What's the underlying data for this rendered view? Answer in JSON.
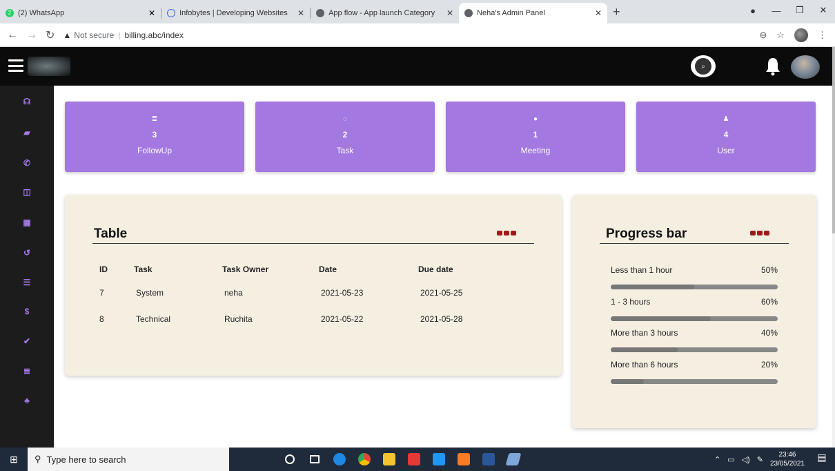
{
  "browser": {
    "tabs": [
      {
        "title": "(2) WhatsApp",
        "favicon_color": "#25d366",
        "favicon_text": "2"
      },
      {
        "title": "Infobytes | Developing Websites",
        "favicon_color": "#3d6bd9"
      },
      {
        "title": "App flow - App launch Category",
        "favicon_color": "#5f6368"
      },
      {
        "title": "Neha's Admin Panel",
        "favicon_color": "#5f6368",
        "active": true
      }
    ],
    "new_tab": "+",
    "address": {
      "security": "Not secure",
      "url": "billing.abc/index"
    }
  },
  "header": {
    "menu_icon": "hamburger-icon",
    "search_icon": "search-icon",
    "bell_icon": "bell-icon"
  },
  "sidebar": {
    "items": [
      {
        "icon": "dashboard-icon",
        "glyph": "☊"
      },
      {
        "icon": "briefcase-icon",
        "glyph": "▰"
      },
      {
        "icon": "phone-icon",
        "glyph": "✆"
      },
      {
        "icon": "columns-icon",
        "glyph": "◫"
      },
      {
        "icon": "calendar-icon",
        "glyph": "▦"
      },
      {
        "icon": "history-icon",
        "glyph": "↺"
      },
      {
        "icon": "list-icon",
        "glyph": "☰"
      },
      {
        "icon": "dollar-icon",
        "glyph": "$"
      },
      {
        "icon": "check-icon",
        "glyph": "✔"
      },
      {
        "icon": "tasks-icon",
        "glyph": "≣"
      },
      {
        "icon": "users-icon",
        "glyph": "♣"
      }
    ]
  },
  "cards": [
    {
      "icon": "list-icon",
      "glyph": "≣",
      "value": "3",
      "label": "FollowUp"
    },
    {
      "icon": "spinner-icon",
      "glyph": "◌",
      "value": "2",
      "label": "Task"
    },
    {
      "icon": "check-circle-icon",
      "glyph": "●",
      "value": "1",
      "label": "Meeting"
    },
    {
      "icon": "user-icon",
      "glyph": "♟",
      "value": "4",
      "label": "User"
    }
  ],
  "table_panel": {
    "title": "Table",
    "columns": [
      "ID",
      "Task",
      "Task Owner",
      "Date",
      "Due date"
    ],
    "rows": [
      [
        "7",
        "System",
        "neha",
        "2021-05-23",
        "2021-05-25"
      ],
      [
        "8",
        "Technical",
        "Ruchita",
        "2021-05-22",
        "2021-05-28"
      ]
    ]
  },
  "progress_panel": {
    "title": "Progress bar",
    "items": [
      {
        "label": "Less than 1 hour",
        "percent_label": "50%",
        "value": 50
      },
      {
        "label": "1 - 3 hours",
        "percent_label": "60%",
        "value": 60
      },
      {
        "label": "More than 3 hours",
        "percent_label": "40%",
        "value": 40
      },
      {
        "label": "More than 6 hours",
        "percent_label": "20%",
        "value": 20
      }
    ]
  },
  "taskbar": {
    "search_placeholder": "Type here to search",
    "time": "23:46",
    "date": "23/05/2021"
  },
  "colors": {
    "accent": "#a378e0",
    "panel_bg": "#f5efe2",
    "header_bg": "#0b0b0b",
    "sidebar_bg": "#1c1c1c",
    "dots": "#a31919"
  }
}
